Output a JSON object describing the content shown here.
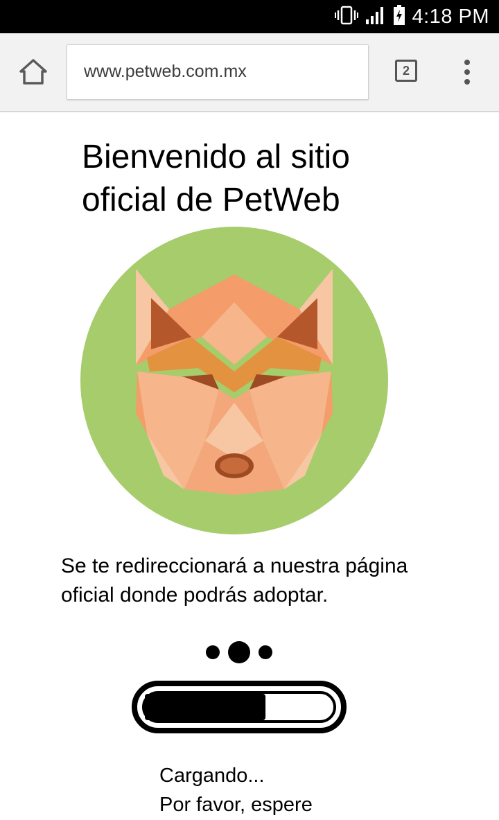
{
  "status_bar": {
    "time": "4:18 PM",
    "icons": [
      "vibrate-icon",
      "signal-icon",
      "battery-charging-icon"
    ]
  },
  "browser": {
    "url": "www.petweb.com.mx",
    "tab_count": "2",
    "icons": [
      "home-icon",
      "overflow-menu-icon"
    ]
  },
  "page": {
    "headline_line1": "Bienvenido al sitio",
    "headline_line2": "oficial de PetWeb",
    "logo_icon": "fox-logo-icon",
    "redirect_line1": "Se te redireccionará a nuestra página",
    "redirect_line2": "oficial donde podrás adoptar.",
    "loading_line1": "Cargando...",
    "loading_line2": "Por favor, espere",
    "progress": 0.64
  },
  "colors": {
    "logo_circle": "#a6cc6c",
    "fox_primary": "#f4a77a",
    "fox_accent": "#e3923f",
    "fox_dark": "#b4582c"
  }
}
